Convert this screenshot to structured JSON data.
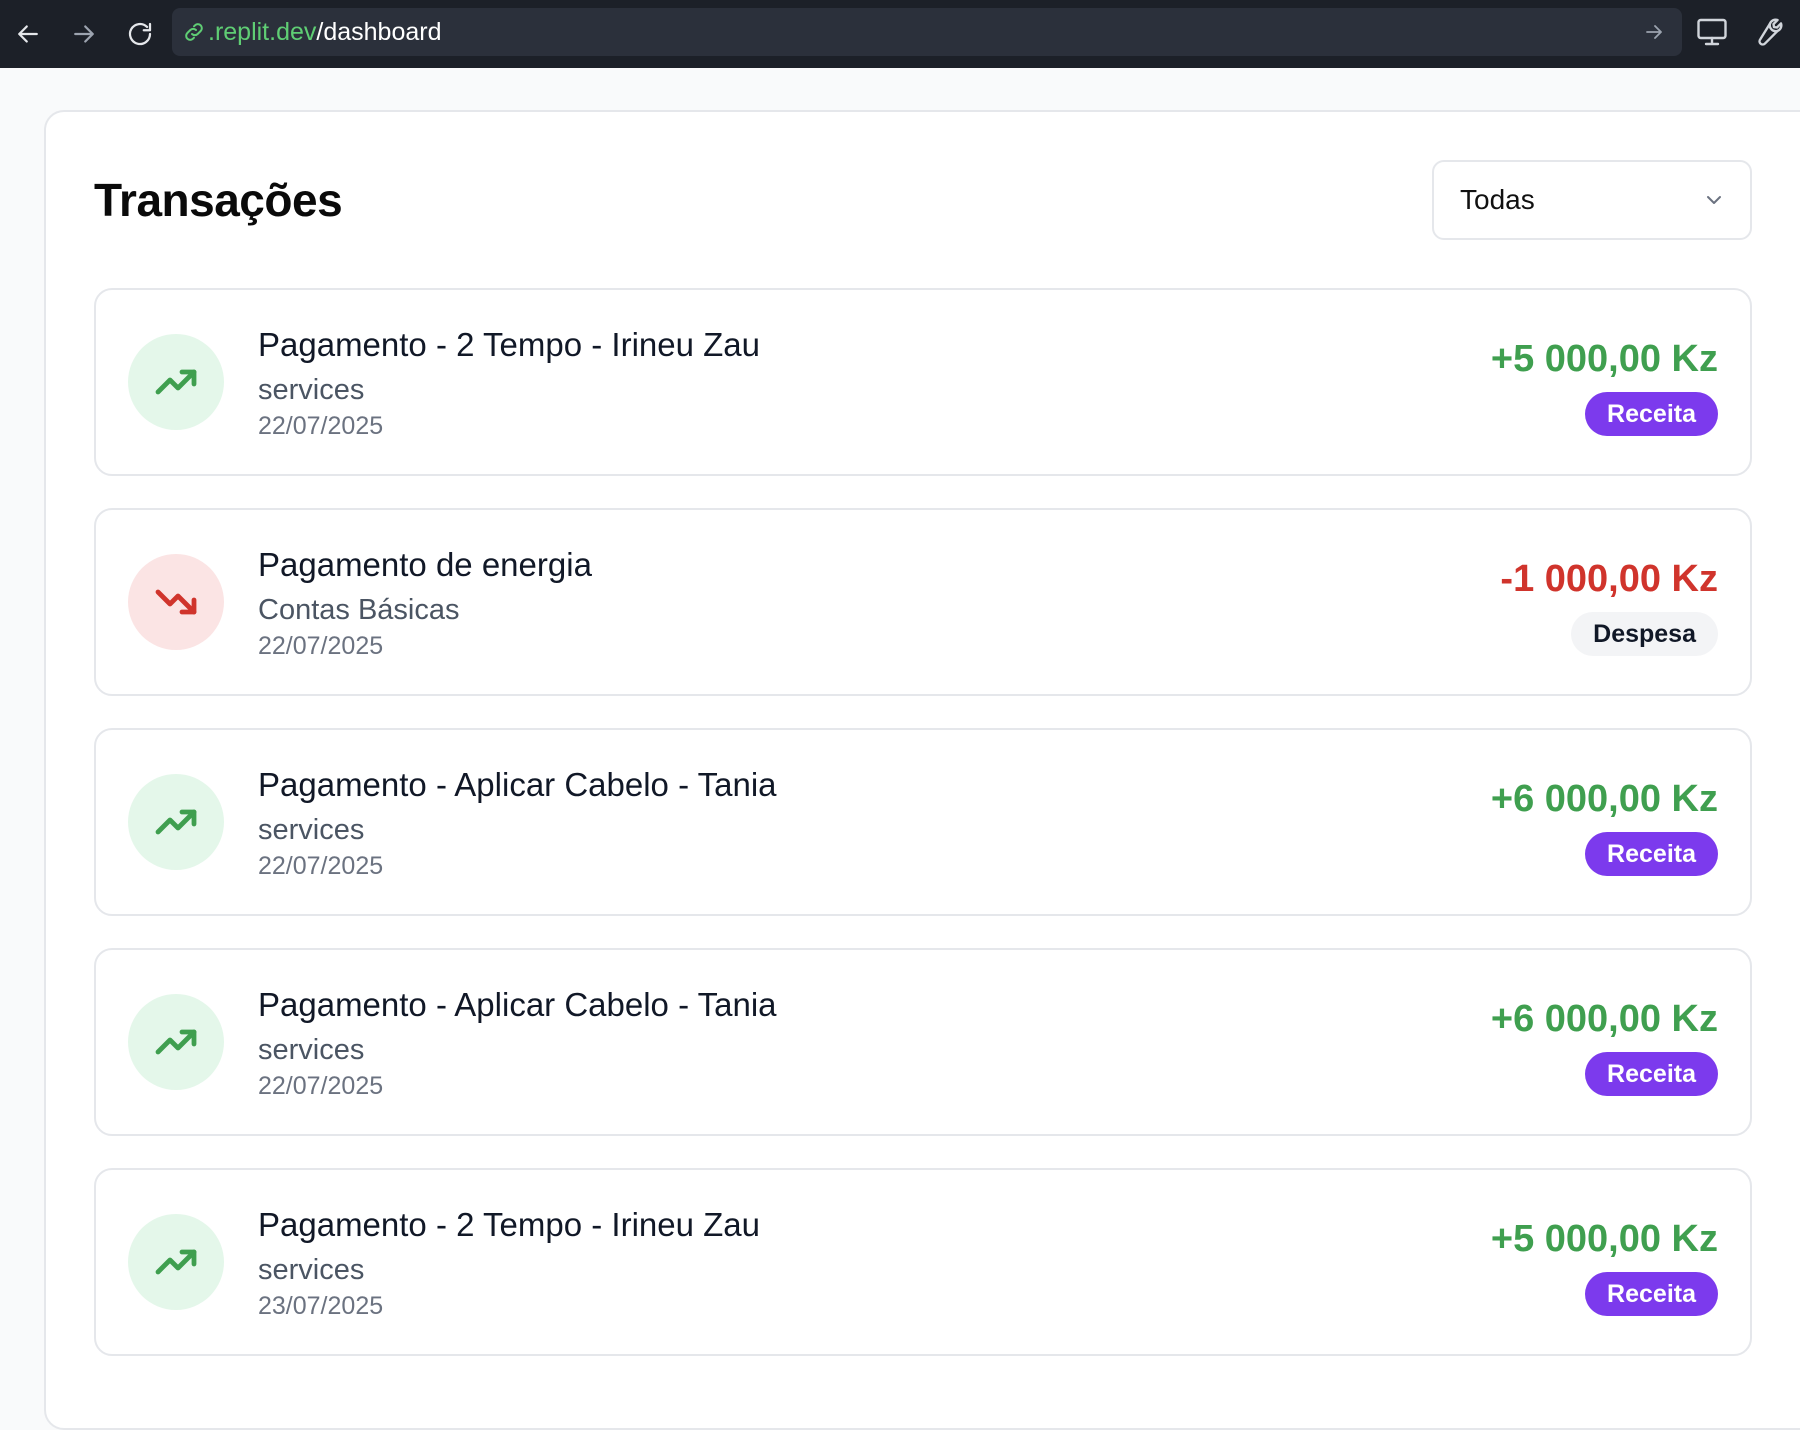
{
  "browser": {
    "url_domain": ".replit.dev",
    "url_path": "/dashboard"
  },
  "page": {
    "title": "Transações",
    "filter": {
      "selected": "Todas"
    }
  },
  "transactions": [
    {
      "title": "Pagamento - 2 Tempo - Irineu Zau",
      "category": "services",
      "date": "22/07/2025",
      "amount": "+5 000,00 Kz",
      "type_label": "Receita",
      "kind": "income"
    },
    {
      "title": "Pagamento de energia",
      "category": "Contas Básicas",
      "date": "22/07/2025",
      "amount": "-1 000,00 Kz",
      "type_label": "Despesa",
      "kind": "expense"
    },
    {
      "title": "Pagamento - Aplicar Cabelo - Tania",
      "category": "services",
      "date": "22/07/2025",
      "amount": "+6 000,00 Kz",
      "type_label": "Receita",
      "kind": "income"
    },
    {
      "title": "Pagamento - Aplicar Cabelo - Tania",
      "category": "services",
      "date": "22/07/2025",
      "amount": "+6 000,00 Kz",
      "type_label": "Receita",
      "kind": "income"
    },
    {
      "title": "Pagamento - 2 Tempo - Irineu Zau",
      "category": "services",
      "date": "23/07/2025",
      "amount": "+5 000,00 Kz",
      "type_label": "Receita",
      "kind": "income"
    }
  ],
  "icons": {
    "income": "trending-up-icon",
    "expense": "trending-down-icon"
  },
  "colors": {
    "income": "#3f9f4f",
    "expense": "#d0342c",
    "receita_badge": "#7c3aed",
    "url_domain": "#5fce74"
  }
}
